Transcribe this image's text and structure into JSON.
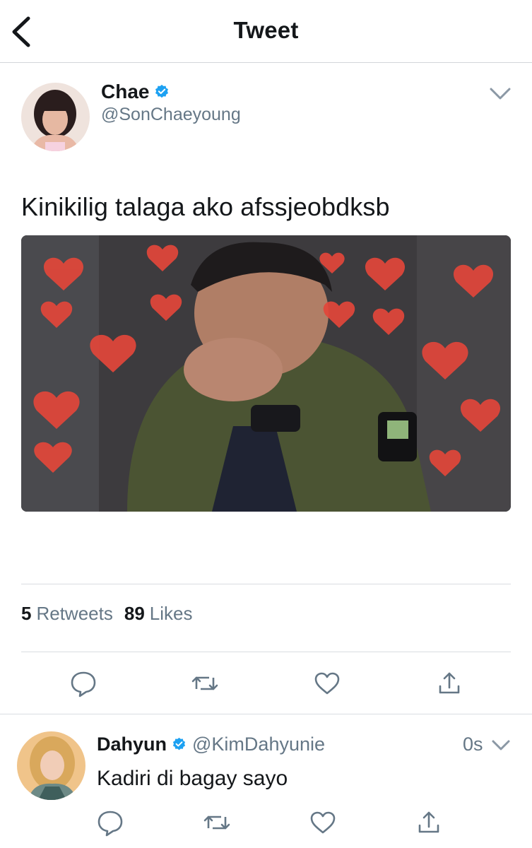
{
  "header": {
    "title": "Tweet",
    "back_icon": "chevron-left-icon"
  },
  "tweet": {
    "author": {
      "name": "Chae",
      "handle": "@SonChaeyoung",
      "verified": true
    },
    "text": "Kinikilig talaga ako afssjeobdksb",
    "media": {
      "description_icon": "photo"
    },
    "stats": {
      "retweets": "5",
      "retweets_label": "Retweets",
      "likes": "89",
      "likes_label": "Likes"
    },
    "actions": [
      "reply-icon",
      "retweet-icon",
      "like-icon",
      "share-icon"
    ]
  },
  "reply": {
    "author": {
      "name": "Dahyun",
      "handle": "@KimDahyunie",
      "verified": true
    },
    "time": "0s",
    "text": "Kadiri di bagay sayo",
    "actions": [
      "reply-icon",
      "retweet-icon",
      "like-icon",
      "share-icon"
    ]
  },
  "colors": {
    "verified": "#1da1f2",
    "icon": "#657786",
    "secondary_text": "#657786",
    "divider": "#d9dde1"
  }
}
